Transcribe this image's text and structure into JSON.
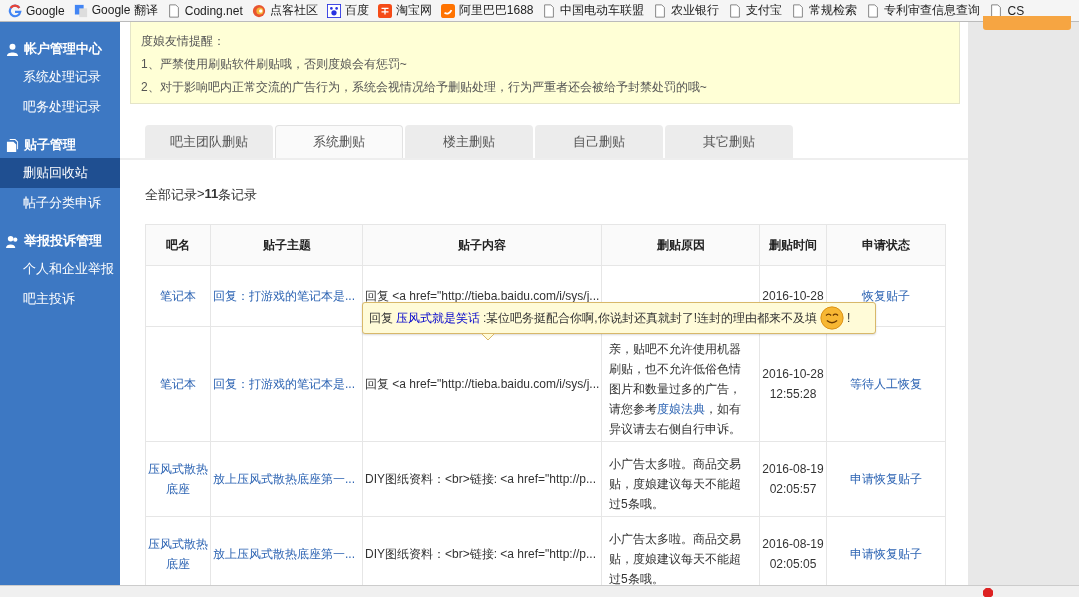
{
  "bookmarks": [
    {
      "kind": "g",
      "label": "Google"
    },
    {
      "kind": "translate",
      "label": "Google 翻译"
    },
    {
      "kind": "page",
      "label": "Coding.net"
    },
    {
      "kind": "swirl",
      "label": "点客社区"
    },
    {
      "kind": "paw",
      "label": "百度"
    },
    {
      "kind": "tao",
      "label": "淘宝网"
    },
    {
      "kind": "ali",
      "label": "阿里巴巴1688"
    },
    {
      "kind": "page",
      "label": "中国电动车联盟"
    },
    {
      "kind": "page",
      "label": "农业银行"
    },
    {
      "kind": "page",
      "label": "支付宝"
    },
    {
      "kind": "page",
      "label": "常规检索"
    },
    {
      "kind": "page",
      "label": "专利审查信息查询"
    },
    {
      "kind": "page",
      "label": "CS"
    }
  ],
  "sidebar": [
    {
      "kind": "person",
      "title": "帐户管理中心",
      "items": [
        {
          "label": "系统处理记录",
          "selected": false
        },
        {
          "label": "吧务处理记录",
          "selected": false
        }
      ]
    },
    {
      "kind": "doc",
      "title": "贴子管理",
      "items": [
        {
          "label": "删贴回收站",
          "selected": true
        },
        {
          "label": "帖子分类申诉",
          "selected": false
        }
      ]
    },
    {
      "kind": "people",
      "title": "举报投诉管理",
      "items": [
        {
          "label": "个人和企业举报",
          "selected": false
        },
        {
          "label": "吧主投诉",
          "selected": false
        }
      ]
    }
  ],
  "notice": {
    "title": "度娘友情提醒：",
    "lines": [
      "1、严禁使用刷贴软件刷贴哦，否则度娘会有惩罚~",
      "2、对于影响吧内正常交流的广告行为，系统会视情况给予删贴处理，行为严重者还会被给予封禁处罚的哦~"
    ]
  },
  "tabs": [
    {
      "label": "吧主团队删贴",
      "selected": false
    },
    {
      "label": "系统删贴",
      "selected": true
    },
    {
      "label": "楼主删贴",
      "selected": false
    },
    {
      "label": "自己删贴",
      "selected": false
    },
    {
      "label": "其它删贴",
      "selected": false
    }
  ],
  "breadcrumb": {
    "root": "全部记录",
    "separator": ">",
    "count": "11",
    "suffix": "条记录"
  },
  "table": {
    "columns": [
      "吧名",
      "贴子主题",
      "贴子内容",
      "删贴原因",
      "删贴时间",
      "申请状态"
    ],
    "rows": [
      {
        "forum": "笔记本",
        "topic": "回复：打游戏的笔记本是...",
        "content": "回复 <a href=\"http://tieba.baidu.com/i/sys/j...",
        "reason": "",
        "time": "2016-10-28",
        "status": "恢复贴子"
      },
      {
        "forum": "笔记本",
        "topic": "回复：打游戏的笔记本是...",
        "content": "回复 <a href=\"http://tieba.baidu.com/i/sys/j...",
        "reason": "亲，贴吧不允许使用机器刷贴，也不允许低俗色情图片和数量过多的广告，请您参考**度娘法典**，如有异议请去右侧自行申诉。",
        "time": "2016-10-28\n12:55:28",
        "status": "等待人工恢复"
      },
      {
        "forum": "压风式散热底座",
        "topic": "放上压风式散热底座第一...",
        "content": "DIY图纸资料：<br>链接: <a href=\"http://p...",
        "reason": "小广告太多啦。商品交易贴，度娘建议每天不能超过5条哦。",
        "time": "2016-08-19\n02:05:57",
        "status": "申请恢复贴子"
      },
      {
        "forum": "压风式散热底座",
        "topic": "放上压风式散热底座第一...",
        "content": "DIY图纸资料：<br>链接: <a href=\"http://p...",
        "reason": "小广告太多啦。商品交易贴，度娘建议每天不能超过5条哦。",
        "time": "2016-08-19\n02:05:05",
        "status": "申请恢复贴子"
      }
    ]
  },
  "tooltip": {
    "prefix": "回复",
    "user": "压风式就是笑话",
    "message": ":某位吧务挺配合你啊,你说封还真就封了!连封的理由都来不及填",
    "end": "!"
  }
}
